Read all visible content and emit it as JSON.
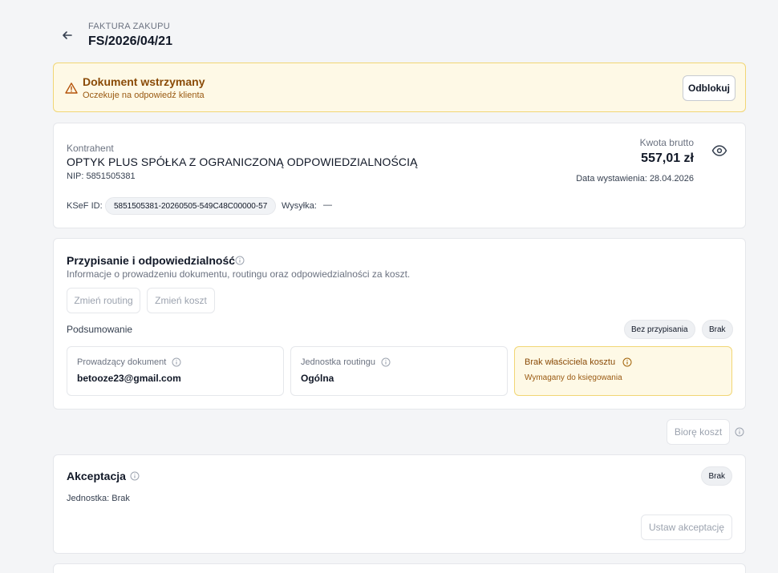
{
  "header": {
    "eyebrow": "FAKTURA ZAKUPU",
    "title": "FS/2026/04/21"
  },
  "banner": {
    "title": "Dokument wstrzymany",
    "subtitle": "Oczekuje na odpowiedź klienta",
    "button": "Odblokuj"
  },
  "contractor": {
    "label": "Kontrahent",
    "name": "OPTYK PLUS SPÓŁKA Z OGRANICZONĄ ODPOWIEDZIALNOŚCIĄ",
    "nip": "NIP: 5851505381",
    "ksef_label": "KSeF ID:",
    "ksef_id": "5851505381-20260505-549C48C00000-57",
    "wysylka_label": "Wysyłka:",
    "wysylka_value": "—",
    "amount_label": "Kwota brutto",
    "amount": "557,01 zł",
    "issue_date": "Data wystawienia: 28.04.2026"
  },
  "assignment": {
    "title": "Przypisanie i odpowiedzialność",
    "subtitle": "Informacje o prowadzeniu dokumentu, routingu oraz odpowiedzialności za koszt.",
    "btn_routing": "Zmień routing",
    "btn_cost": "Zmień koszt",
    "summary_label": "Podsumowanie",
    "pill_unassigned": "Bez przypisania",
    "pill_none": "Brak",
    "owner_label": "Prowadzący dokument",
    "owner_value": "betooze23@gmail.com",
    "routing_label": "Jednostka routingu",
    "routing_value": "Ogólna",
    "cost_owner_label": "Brak właściciela kosztu",
    "cost_owner_note": "Wymagany do księgowania"
  },
  "take_cost": {
    "button": "Biorę koszt"
  },
  "acceptance": {
    "title": "Akceptacja",
    "pill": "Brak",
    "unit": "Jednostka: Brak",
    "button": "Ustaw akceptację"
  },
  "colors": {
    "warning_bg": "#fef9e6",
    "warning_border": "#f1d675",
    "warning_text": "#8a4b08",
    "page_bg": "#f4f5f7"
  },
  "icons": [
    "arrow-left-icon",
    "warning-triangle-icon",
    "eye-icon",
    "info-icon"
  ]
}
